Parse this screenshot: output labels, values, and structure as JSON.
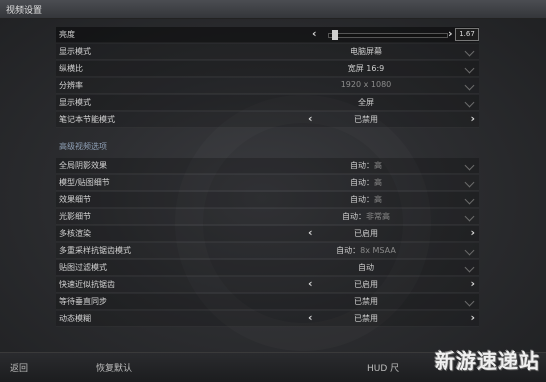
{
  "window": {
    "title": "视频设置"
  },
  "basic_settings": [
    {
      "label": "亮度",
      "control": "slider",
      "value": "1.67",
      "fraction": 0.05
    },
    {
      "label": "显示模式",
      "control": "dropdown",
      "value": "电脑屏幕"
    },
    {
      "label": "纵横比",
      "control": "dropdown",
      "value": "宽屏 16:9"
    },
    {
      "label": "分辨率",
      "control": "dropdown",
      "value": "1920 x 1080"
    },
    {
      "label": "显示模式",
      "control": "dropdown",
      "value": "全屏"
    },
    {
      "label": "笔记本节能模式",
      "control": "toggle",
      "value": "已禁用"
    }
  ],
  "advanced_section": {
    "title": "高级视频选项"
  },
  "advanced_settings": [
    {
      "label": "全局阴影效果",
      "control": "dropdown",
      "value": "自动：",
      "sub": "高"
    },
    {
      "label": "模型/贴图细节",
      "control": "dropdown",
      "value": "自动：",
      "sub": "高"
    },
    {
      "label": "效果细节",
      "control": "dropdown",
      "value": "自动：",
      "sub": "高"
    },
    {
      "label": "光影细节",
      "control": "dropdown",
      "value": "自动：",
      "sub": "非常高"
    },
    {
      "label": "多核渲染",
      "control": "toggle",
      "value": "已启用"
    },
    {
      "label": "多重采样抗锯齿模式",
      "control": "dropdown",
      "value": "自动：",
      "sub": "8x MSAA"
    },
    {
      "label": "贴图过滤模式",
      "control": "dropdown",
      "value": "自动"
    },
    {
      "label": "快速近似抗锯齿",
      "control": "toggle",
      "value": "已启用"
    },
    {
      "label": "等待垂直同步",
      "control": "dropdown",
      "value": "已禁用"
    },
    {
      "label": "动态模糊",
      "control": "toggle",
      "value": "已禁用"
    }
  ],
  "footer": {
    "back": "返回",
    "reset": "恢复默认",
    "hud": "HUD 尺"
  },
  "watermark": "新游速递站",
  "colors": {
    "accent": "#8fa0b6"
  }
}
